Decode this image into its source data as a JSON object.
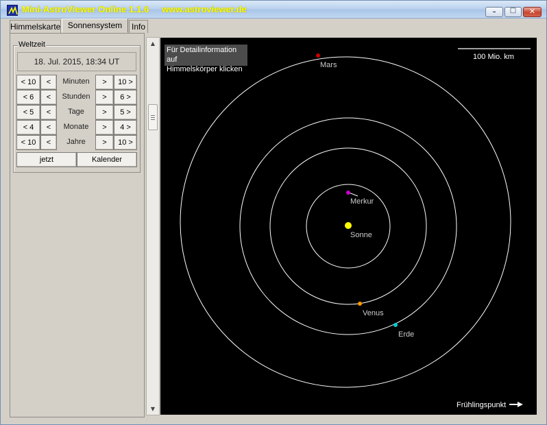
{
  "window": {
    "title": "Mini-AstroViewer Online 1.1.6",
    "url": "www.astroviewer.de",
    "title_color": "#ffff00",
    "buttons": {
      "minimize": "–",
      "maximize": "□",
      "close": "✕"
    }
  },
  "tabs": [
    {
      "label": "Himmelskarte",
      "active": false
    },
    {
      "label": "Sonnensystem",
      "active": true
    },
    {
      "label": "Info",
      "active": false
    }
  ],
  "time_panel": {
    "title": "Weltzeit",
    "datetime": "18. Jul. 2015, 18:34 UT",
    "rows": [
      {
        "back_big": "< 10",
        "back_small": "<",
        "unit": "Minuten",
        "fwd_small": ">",
        "fwd_big": "10 >"
      },
      {
        "back_big": "< 6",
        "back_small": "<",
        "unit": "Stunden",
        "fwd_small": ">",
        "fwd_big": "6 >"
      },
      {
        "back_big": "< 5",
        "back_small": "<",
        "unit": "Tage",
        "fwd_small": ">",
        "fwd_big": "5 >"
      },
      {
        "back_big": "< 4",
        "back_small": "<",
        "unit": "Monate",
        "fwd_small": ">",
        "fwd_big": "4 >"
      },
      {
        "back_big": "< 10",
        "back_small": "<",
        "unit": "Jahre",
        "fwd_small": ">",
        "fwd_big": "10 >"
      }
    ],
    "now_label": "jetzt",
    "calendar_label": "Kalender"
  },
  "scrollbar": {
    "up_icon": "▲",
    "down_icon": "▼"
  },
  "solar_view": {
    "info_text_line1": "Für Detailinformation auf",
    "info_text_line2": "Himmelskörper klicken",
    "scale_label": "100 Mio. km",
    "spring_point_label": "Frühlingspunkt",
    "bodies": [
      {
        "name": "Sonne",
        "color": "#ffff00"
      },
      {
        "name": "Merkur",
        "color": "#cc00cc"
      },
      {
        "name": "Venus",
        "color": "#ff9900"
      },
      {
        "name": "Erde",
        "color": "#00cccc"
      },
      {
        "name": "Mars",
        "color": "#cc0000"
      }
    ]
  }
}
